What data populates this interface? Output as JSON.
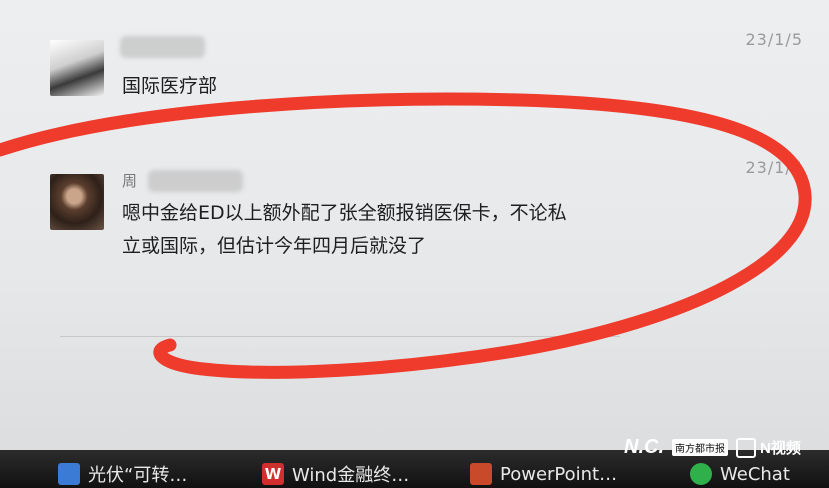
{
  "messages": [
    {
      "date": "23/1/5",
      "text": "国际医疗部"
    },
    {
      "name_prefix": "周",
      "date": "23/1/5",
      "text_line1": "嗯中金给ED以上额外配了张全额报销医保卡，不论私",
      "text_line2": "立或国际，但估计今年四月后就没了"
    }
  ],
  "taskbar": {
    "items": [
      {
        "label": "光伏“可转…",
        "icon": "app-icon"
      },
      {
        "label": "Wind金融终…",
        "icon": "wind-icon"
      },
      {
        "label": "PowerPoint…",
        "icon": "powerpoint-icon"
      },
      {
        "label": "WeChat",
        "icon": "wechat-icon"
      }
    ]
  },
  "watermark": {
    "logo": "N.C.",
    "brand": "南方都市报",
    "video": "N视频"
  },
  "colors": {
    "circle": "#ef3b2c",
    "taskbar": "#1a1a1a"
  }
}
